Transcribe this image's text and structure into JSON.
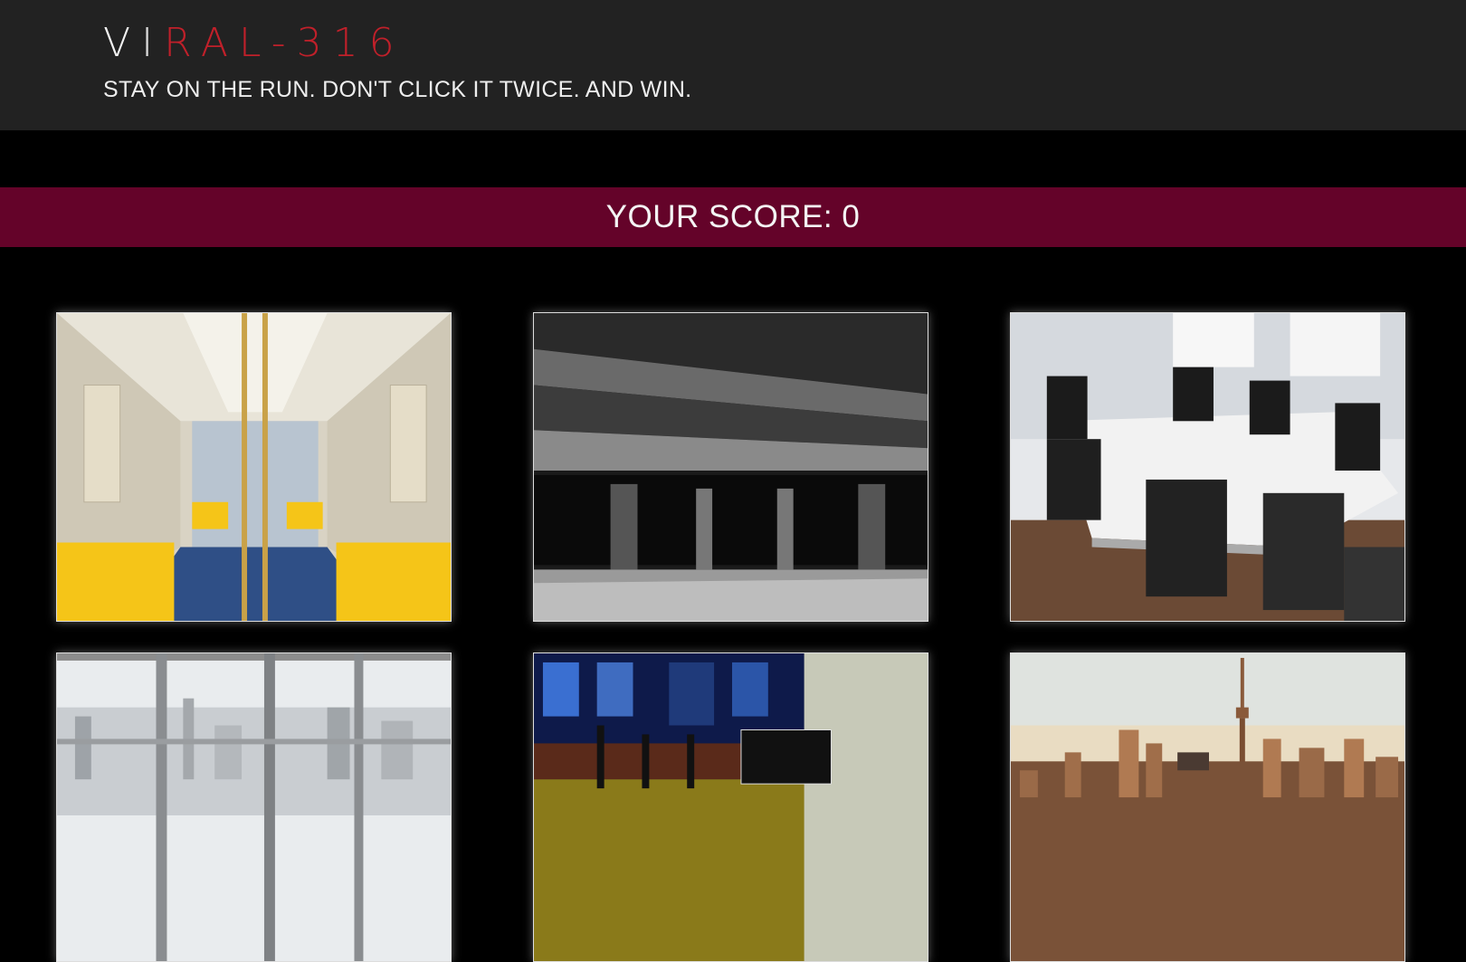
{
  "header": {
    "logo_parts": [
      "V",
      "I",
      "RAL-316"
    ],
    "tagline": "STAY ON THE RUN. DON'T CLICK IT TWICE. AND WIN."
  },
  "score": {
    "label": "YOUR SCORE:",
    "value": "0"
  },
  "colors": {
    "header_bg": "#222222",
    "accent_red": "#c0202a",
    "score_bar": "#640329",
    "page_bg": "#000000"
  },
  "cards": [
    {
      "subject": "subway car interior with yellow seats"
    },
    {
      "subject": "dark parking garage under concrete beams"
    },
    {
      "subject": "conference room with white table and black chairs"
    },
    {
      "subject": "office window overlooking city skyline"
    },
    {
      "subject": "street at night with brick wall and craft beer sign"
    },
    {
      "subject": "city skyline with tall tower at sunset"
    }
  ]
}
